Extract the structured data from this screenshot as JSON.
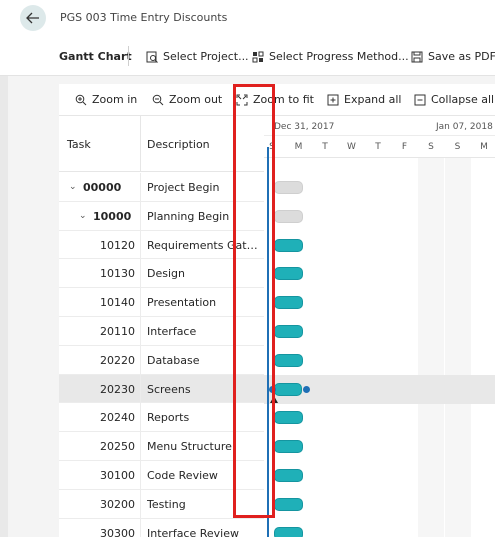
{
  "title": "PGS 003 Time Entry Discounts",
  "actionbar": {
    "gantt_label": "Gantt Chart",
    "select_project": "Select Project...",
    "select_progress": "Select Progress Method...",
    "save_pdf": "Save as PDF..."
  },
  "toolbar": {
    "zoom_in": "Zoom in",
    "zoom_out": "Zoom out",
    "zoom_fit": "Zoom to fit",
    "expand_all": "Expand all",
    "collapse_all": "Collapse all"
  },
  "grid": {
    "col_task": "Task",
    "col_desc": "Description",
    "rows": [
      {
        "task": "00000",
        "desc": "Project Begin",
        "bold": true,
        "level": 0,
        "expander": "⌄"
      },
      {
        "task": "10000",
        "desc": "Planning Begin",
        "bold": true,
        "level": 1,
        "expander": "⌄"
      },
      {
        "task": "10120",
        "desc": "Requirements Gathe...",
        "level": 2
      },
      {
        "task": "10130",
        "desc": "Design",
        "level": 2
      },
      {
        "task": "10140",
        "desc": "Presentation",
        "level": 2
      },
      {
        "task": "20110",
        "desc": "Interface",
        "level": 2
      },
      {
        "task": "20220",
        "desc": "Database",
        "level": 2
      },
      {
        "task": "20230",
        "desc": "Screens",
        "level": 2,
        "selected": true
      },
      {
        "task": "20240",
        "desc": "Reports",
        "level": 2
      },
      {
        "task": "20250",
        "desc": "Menu Structure",
        "level": 2
      },
      {
        "task": "30100",
        "desc": "Code Review",
        "level": 2
      },
      {
        "task": "30200",
        "desc": "Testing",
        "level": 2
      },
      {
        "task": "30300",
        "desc": "Interface Review",
        "level": 2
      }
    ]
  },
  "timeline": {
    "week1": "Dec 31, 2017",
    "week2": "Jan 07, 2018",
    "days": [
      "S",
      "M",
      "T",
      "W",
      "T",
      "F",
      "S",
      "S",
      "M",
      "T"
    ]
  },
  "colors": {
    "bar": "#1fb0b8",
    "summary_bar": "#dcdcdc",
    "today_line": "#1f6fb5",
    "highlight": "#e0201e"
  }
}
